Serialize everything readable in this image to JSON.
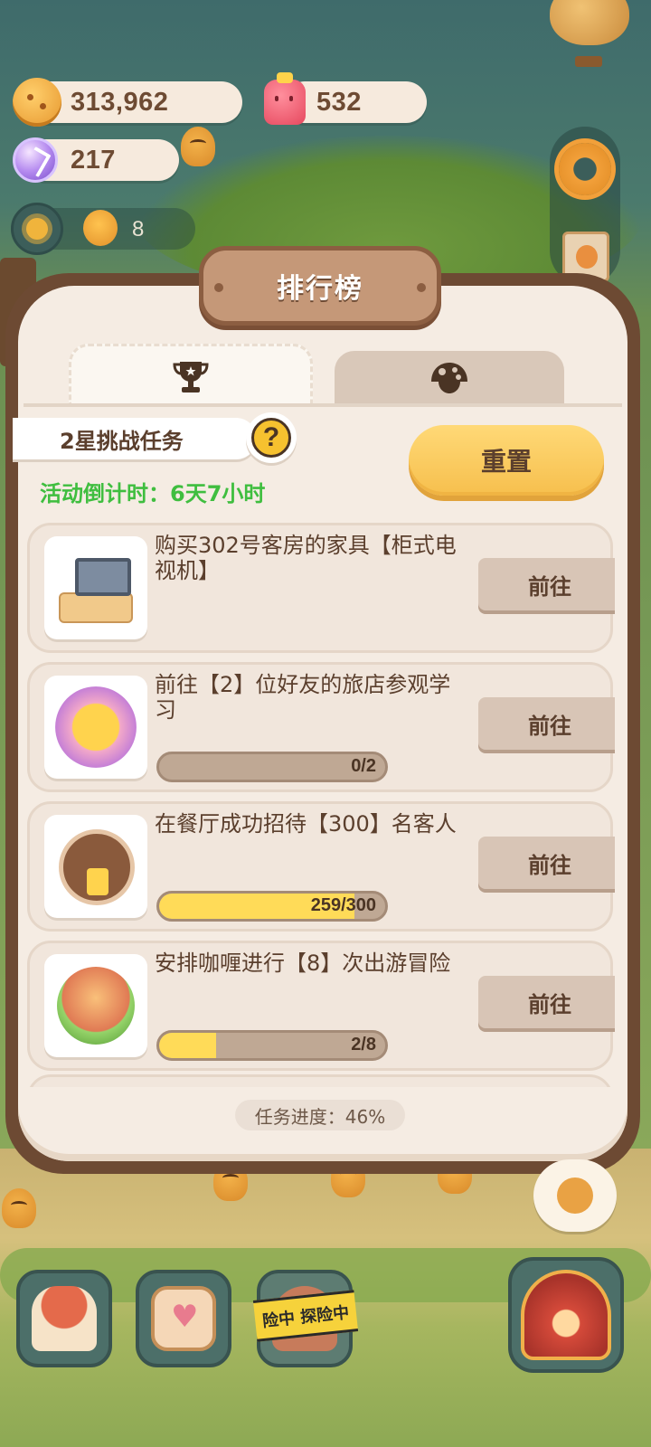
{
  "hud": {
    "cookies": "313,962",
    "jelly": "532",
    "gems": "217",
    "sun_count": "8"
  },
  "panel": {
    "title": "排行榜",
    "tabs": [
      {
        "icon": "trophy-icon"
      },
      {
        "icon": "mushroom-icon"
      }
    ],
    "challenge_label": "2星挑战任务",
    "help_symbol": "?",
    "countdown": "活动倒计时：6天7小时",
    "reset_label": "重置",
    "go_label": "前往",
    "tasks": [
      {
        "title": "购买302号客房的家具【柜式电视机】"
      },
      {
        "title": "前往【2】位好友的旅店参观学习",
        "progress": "0/2",
        "fraction": 0
      },
      {
        "title": "在餐厅成功招待【300】名客人",
        "progress": "259/300",
        "fraction": 0.863
      },
      {
        "title": "安排咖喱进行【8】次出游冒险",
        "progress": "2/8",
        "fraction": 0.25
      }
    ],
    "footer": "任务进度：46%"
  },
  "bottom_nav": {
    "adventure_tape": "险中 探险中"
  },
  "colors": {
    "panel_bg": "#f5ece3",
    "panel_border": "#6d4a33",
    "accent_button": "#f6bf4d",
    "countdown_green": "#3fbe3f",
    "progress_fill": "#ffdb58"
  }
}
